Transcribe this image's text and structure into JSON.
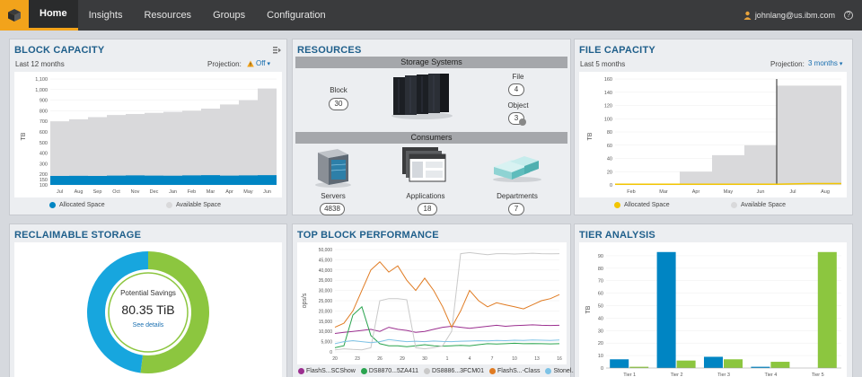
{
  "nav": {
    "items": [
      "Home",
      "Insights",
      "Resources",
      "Groups",
      "Configuration"
    ],
    "active": "Home",
    "user_email": "johnlang@us.ibm.com",
    "help_label": "?"
  },
  "block_capacity": {
    "title": "BLOCK CAPACITY",
    "range": "Last 12 months",
    "projection_label": "Projection:",
    "projection_value": "Off",
    "ylabel": "TB",
    "legend_allocated": "Allocated Space",
    "legend_available": "Available Space"
  },
  "resources": {
    "title": "RESOURCES",
    "storage_systems": "Storage Systems",
    "block_label": "Block",
    "block_count": "30",
    "file_label": "File",
    "file_count": "4",
    "object_label": "Object",
    "object_count": "3",
    "consumers": "Consumers",
    "servers_label": "Servers",
    "servers_count": "4838",
    "applications_label": "Applications",
    "applications_count": "18",
    "departments_label": "Departments",
    "departments_count": "7"
  },
  "file_capacity": {
    "title": "FILE CAPACITY",
    "range": "Last 5 months",
    "projection_label": "Projection:",
    "projection_value": "3 months",
    "ylabel": "TB",
    "legend_allocated": "Allocated Space",
    "legend_available": "Available Space"
  },
  "reclaimable": {
    "title": "RECLAIMABLE STORAGE",
    "center_label": "Potential Savings",
    "center_value": "80.35 TiB",
    "details_link": "See details"
  },
  "top_block": {
    "title": "TOP BLOCK PERFORMANCE",
    "ylabel": "ops/s"
  },
  "tier": {
    "title": "TIER ANALYSIS",
    "ylabel": "TB"
  },
  "colors": {
    "allocated_blue": "#0085c3",
    "available_gray": "#d9d9db",
    "file_allocated": "#f2c500",
    "donut_blue": "#17a6de",
    "donut_green": "#8cc63f",
    "tier_blue": "#0085c3",
    "tier_green": "#8cc63f"
  },
  "chart_data": [
    {
      "type": "area",
      "title": "BLOCK CAPACITY",
      "ylabel": "TB",
      "categories": [
        "Jul",
        "Aug",
        "Sep",
        "Oct",
        "Nov",
        "Dec",
        "Jan",
        "Feb",
        "Mar",
        "Apr",
        "May",
        "Jun"
      ],
      "yticks": [
        100,
        150,
        200,
        300,
        400,
        500,
        600,
        700,
        800,
        900,
        1000,
        1100
      ],
      "ylim": [
        100,
        1100
      ],
      "series": [
        {
          "name": "Allocated Space",
          "values": [
            185,
            186,
            185,
            188,
            190,
            188,
            187,
            190,
            192,
            188,
            190,
            192
          ]
        },
        {
          "name": "Available Space",
          "values": [
            700,
            720,
            740,
            760,
            770,
            780,
            790,
            800,
            820,
            860,
            900,
            1010
          ]
        }
      ]
    },
    {
      "type": "area",
      "title": "FILE CAPACITY",
      "ylabel": "TB",
      "categories": [
        "Feb",
        "Mar",
        "Apr",
        "May",
        "Jun",
        "Jul",
        "Aug"
      ],
      "yticks": [
        0,
        20,
        40,
        60,
        80,
        100,
        120,
        140,
        160
      ],
      "ylim": [
        0,
        160
      ],
      "series": [
        {
          "name": "Allocated Space",
          "values": [
            1,
            1,
            1,
            1,
            1,
            2,
            2
          ]
        },
        {
          "name": "Available Space",
          "values": [
            0,
            0,
            20,
            45,
            60,
            150,
            150
          ]
        }
      ]
    },
    {
      "type": "pie",
      "title": "RECLAIMABLE STORAGE",
      "values": [
        52,
        48
      ]
    },
    {
      "type": "line",
      "title": "TOP BLOCK PERFORMANCE",
      "ylabel": "ops/s",
      "x": [
        20,
        22,
        23,
        24,
        25,
        26,
        27,
        28,
        29,
        30,
        31,
        2,
        3,
        4,
        5,
        6,
        7,
        8,
        9,
        10,
        11,
        12,
        13,
        14,
        15,
        16
      ],
      "xticks": [
        "20",
        "23",
        "26",
        "29",
        "30",
        "1",
        "4",
        "7",
        "10",
        "13",
        "16"
      ],
      "yticks": [
        0,
        5000,
        10000,
        15000,
        20000,
        25000,
        30000,
        35000,
        40000,
        45000,
        50000
      ],
      "ylim": [
        0,
        50000
      ],
      "series": [
        {
          "name": "FlashS...SCShow",
          "values": [
            9000,
            9500,
            10000,
            10500,
            11000,
            10000,
            12000,
            11000,
            10500,
            9500,
            10000,
            11000,
            12000,
            12500,
            12000,
            11500,
            12000,
            12500,
            13000,
            12500,
            12800,
            13000,
            13200,
            13000,
            12900,
            13000
          ]
        },
        {
          "name": "DS8870...5ZA411",
          "values": [
            2000,
            3000,
            18000,
            22000,
            8000,
            4000,
            3000,
            3000,
            2500,
            3000,
            3500,
            3000,
            2800,
            3000,
            3200,
            3000,
            3500,
            4000,
            3800,
            4000,
            4200,
            4000,
            4100,
            4000,
            3900,
            4000
          ]
        },
        {
          "name": "DS8886...3FCM01",
          "values": [
            1000,
            1500,
            1200,
            1000,
            2000,
            25000,
            26000,
            26000,
            25500,
            2000,
            1500,
            2000,
            3000,
            10000,
            48000,
            48500,
            48000,
            47500,
            48000,
            48000,
            47800,
            48000,
            48200,
            48000,
            47900,
            48000
          ]
        },
        {
          "name": "FlashS...-Class",
          "values": [
            12000,
            14000,
            20000,
            30000,
            40000,
            44000,
            39000,
            42000,
            35000,
            30000,
            36000,
            30000,
            22000,
            12000,
            20000,
            30000,
            25000,
            22000,
            24000,
            23000,
            22000,
            21000,
            23000,
            25000,
            26000,
            28000
          ]
        },
        {
          "name": "Stonel...-Class",
          "values": [
            4000,
            5000,
            5500,
            5000,
            4500,
            5000,
            6000,
            5500,
            5000,
            5200,
            5000,
            5300,
            5100,
            5000,
            5200,
            5300,
            5500,
            5400,
            5600,
            5500,
            5700,
            5600,
            5800,
            5700,
            5600,
            5800
          ]
        }
      ]
    },
    {
      "type": "bar",
      "title": "TIER ANALYSIS",
      "ylabel": "TB",
      "categories": [
        "Tier 1",
        "Tier 2",
        "Tier 3",
        "Tier 4",
        "Tier 5"
      ],
      "yticks": [
        0,
        10,
        20,
        30,
        40,
        50,
        60,
        70,
        80,
        90
      ],
      "ylim": [
        0,
        95
      ],
      "series": [
        {
          "values": [
            7,
            93,
            9,
            1,
            0
          ]
        },
        {
          "values": [
            1,
            6,
            7,
            5,
            93
          ]
        }
      ]
    }
  ]
}
